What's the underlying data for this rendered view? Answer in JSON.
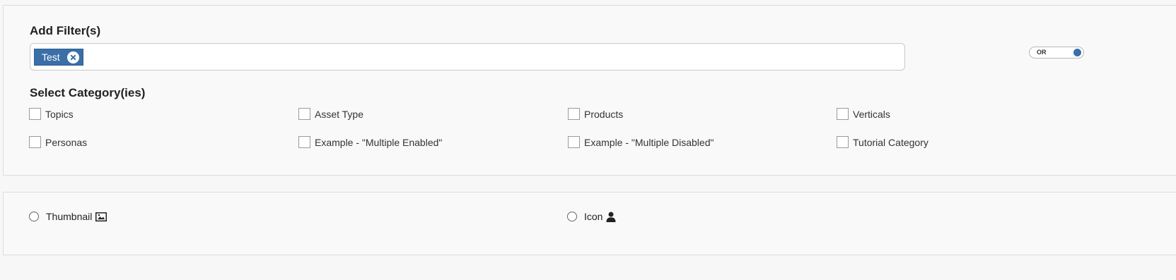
{
  "filters": {
    "title": "Add Filter(s)",
    "chips": [
      {
        "label": "Test",
        "remove_icon": "close-circle-icon"
      }
    ],
    "mode_toggle": {
      "label": "OR",
      "state": "on",
      "accent": "#3a6fa8"
    }
  },
  "categories": {
    "title": "Select Category(ies)",
    "items": [
      {
        "label": "Topics",
        "checked": false
      },
      {
        "label": "Asset Type",
        "checked": false
      },
      {
        "label": "Products",
        "checked": false
      },
      {
        "label": "Verticals",
        "checked": false
      },
      {
        "label": "Personas",
        "checked": false
      },
      {
        "label": "Example - \"Multiple Enabled\"",
        "checked": false
      },
      {
        "label": "Example - \"Multiple Disabled\"",
        "checked": false
      },
      {
        "label": "Tutorial Category",
        "checked": false
      }
    ]
  },
  "display": {
    "options": [
      {
        "label": "Thumbnail",
        "icon": "image-icon",
        "selected": false
      },
      {
        "label": "Icon",
        "icon": "user-icon",
        "selected": false
      }
    ]
  }
}
